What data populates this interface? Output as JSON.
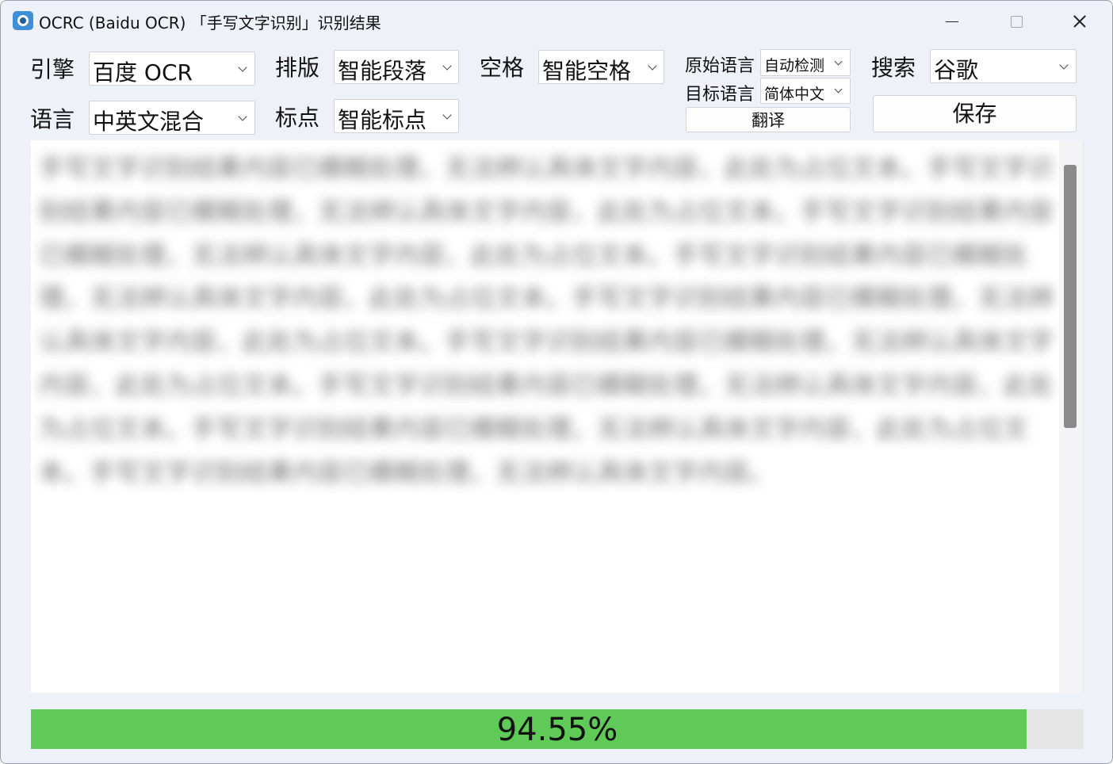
{
  "window": {
    "title": "OCRC (Baidu OCR) 「手写文字识别」识别结果"
  },
  "toolbar": {
    "engine_label": "引擎",
    "engine_value": "百度 OCR",
    "language_label": "语言",
    "language_value": "中英文混合",
    "layout_label": "排版",
    "layout_value": "智能段落",
    "punct_label": "标点",
    "punct_value": "智能标点",
    "space_label": "空格",
    "space_value": "智能空格",
    "source_lang_label": "原始语言",
    "source_lang_value": "自动检测",
    "target_lang_label": "目标语言",
    "target_lang_value": "简体中文",
    "translate_label": "翻译",
    "search_label": "搜索",
    "search_value": "谷歌",
    "save_label": "保存"
  },
  "result": {
    "text": "手写文字识别结果内容已模糊处理，无法辨认具体文字内容，此处为占位文本。手写文字识别结果内容已模糊处理，无法辨认具体文字内容，此处为占位文本。手写文字识别结果内容已模糊处理，无法辨认具体文字内容，此处为占位文本。手写文字识别结果内容已模糊处理，无法辨认具体文字内容，此处为占位文本。手写文字识别结果内容已模糊处理，无法辨认具体文字内容，此处为占位文本。手写文字识别结果内容已模糊处理，无法辨认具体文字内容，此处为占位文本。手写文字识别结果内容已模糊处理，无法辨认具体文字内容，此处为占位文本。手写文字识别结果内容已模糊处理，无法辨认具体文字内容，此处为占位文本。手写文字识别结果内容已模糊处理，无法辨认具体文字内容。",
    "blurred": true
  },
  "progress": {
    "value": 0.9455,
    "label": "94.55%",
    "fill_color": "#5fca57"
  }
}
